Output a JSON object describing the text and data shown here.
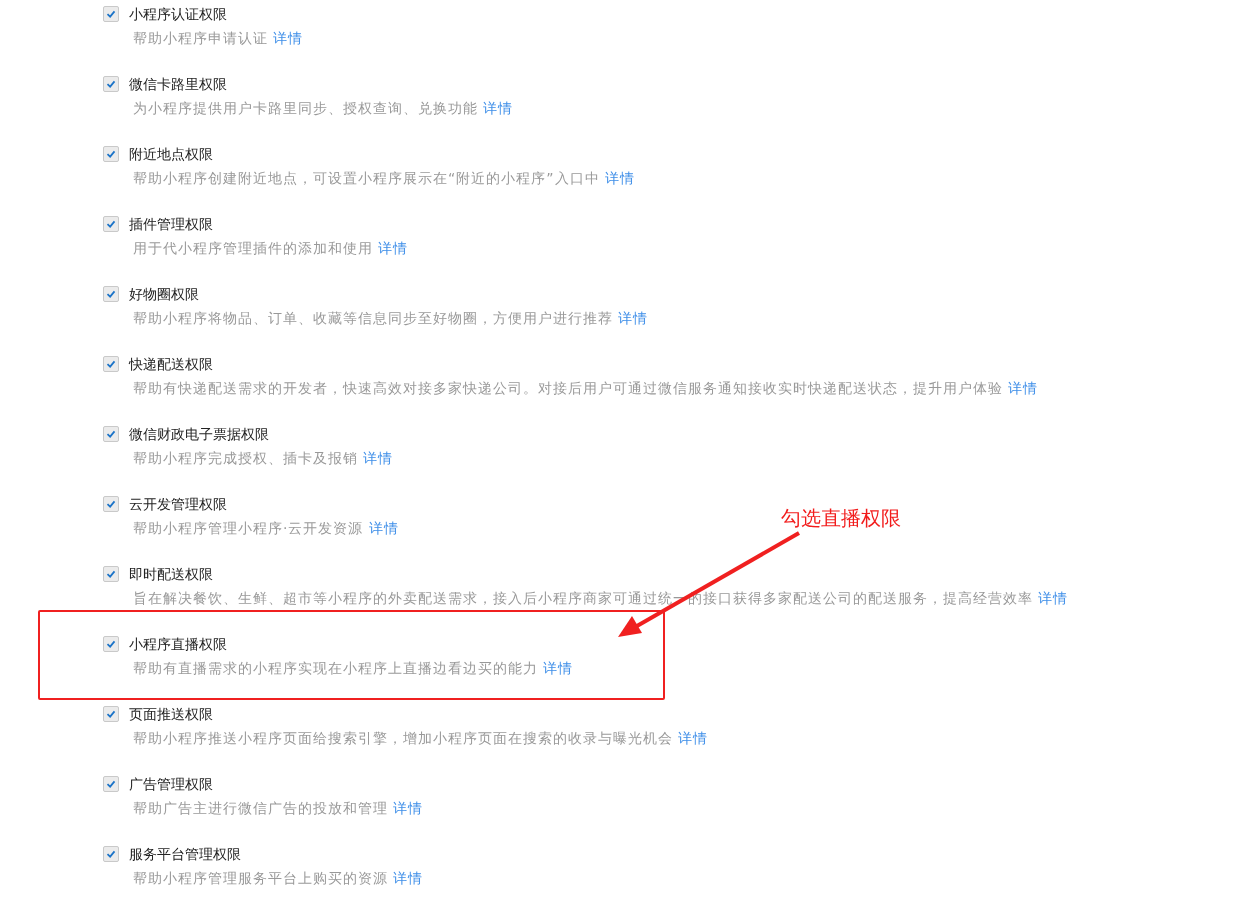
{
  "permissions": [
    {
      "title": "小程序认证权限",
      "description": "帮助小程序申请认证",
      "link": "详情",
      "checked": true,
      "highlighted": false
    },
    {
      "title": "微信卡路里权限",
      "description": "为小程序提供用户卡路里同步、授权查询、兑换功能",
      "link": "详情",
      "checked": true,
      "highlighted": false
    },
    {
      "title": "附近地点权限",
      "description": "帮助小程序创建附近地点，可设置小程序展示在“附近的小程序”入口中",
      "link": "详情",
      "checked": true,
      "highlighted": false
    },
    {
      "title": "插件管理权限",
      "description": "用于代小程序管理插件的添加和使用",
      "link": "详情",
      "checked": true,
      "highlighted": false
    },
    {
      "title": "好物圈权限",
      "description": "帮助小程序将物品、订单、收藏等信息同步至好物圈，方便用户进行推荐",
      "link": "详情",
      "checked": true,
      "highlighted": false
    },
    {
      "title": "快递配送权限",
      "description": "帮助有快递配送需求的开发者，快速高效对接多家快递公司。对接后用户可通过微信服务通知接收实时快递配送状态，提升用户体验",
      "link": "详情",
      "checked": true,
      "highlighted": false
    },
    {
      "title": "微信财政电子票据权限",
      "description": "帮助小程序完成授权、插卡及报销",
      "link": "详情",
      "checked": true,
      "highlighted": false
    },
    {
      "title": "云开发管理权限",
      "description": "帮助小程序管理小程序·云开发资源",
      "link": "详情",
      "checked": true,
      "highlighted": false
    },
    {
      "title": "即时配送权限",
      "description": "旨在解决餐饮、生鲜、超市等小程序的外卖配送需求，接入后小程序商家可通过统一的接口获得多家配送公司的配送服务，提高经营效率",
      "link": "详情",
      "checked": true,
      "highlighted": false
    },
    {
      "title": "小程序直播权限",
      "description": "帮助有直播需求的小程序实现在小程序上直播边看边买的能力",
      "link": "详情",
      "checked": true,
      "highlighted": true
    },
    {
      "title": "页面推送权限",
      "description": "帮助小程序推送小程序页面给搜索引擎，增加小程序页面在搜索的收录与曝光机会",
      "link": "详情",
      "checked": true,
      "highlighted": false
    },
    {
      "title": "广告管理权限",
      "description": "帮助广告主进行微信广告的投放和管理",
      "link": "详情",
      "checked": true,
      "highlighted": false
    },
    {
      "title": "服务平台管理权限",
      "description": "帮助小程序管理服务平台上购买的资源",
      "link": "详情",
      "checked": true,
      "highlighted": false
    }
  ],
  "annotation": {
    "text": "勾选直播权限"
  }
}
